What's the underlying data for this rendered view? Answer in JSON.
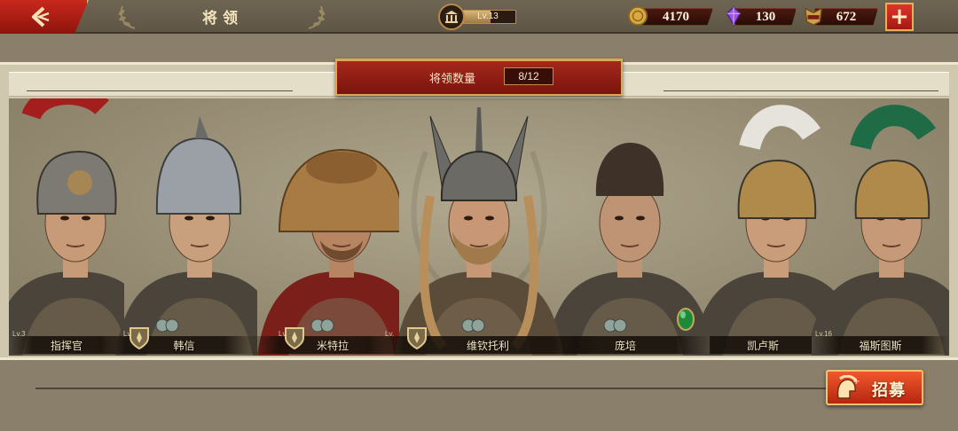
{
  "header": {
    "title": "将领",
    "level_label": "Lv.13",
    "level_progress": 0.55
  },
  "resources": [
    {
      "name": "gold",
      "icon": "gold-coin-icon",
      "value": "4170"
    },
    {
      "name": "gems",
      "icon": "purple-gem-icon",
      "value": "130"
    },
    {
      "name": "spqr",
      "icon": "spqr-token-icon",
      "value": "672"
    }
  ],
  "roster": {
    "count_label": "将领数量",
    "count_value": "8/12",
    "generals": [
      {
        "name": "指挥官",
        "level": "Lv.3",
        "has_shield": false,
        "has_coins": false,
        "has_gem": false,
        "helmet": "roman-red"
      },
      {
        "name": "韩信",
        "level": "Lv.1",
        "has_shield": true,
        "has_coins": true,
        "has_gem": false,
        "helmet": "han-steel"
      },
      {
        "name": "米特拉",
        "level": "Lv.45",
        "has_shield": true,
        "has_coins": true,
        "has_gem": false,
        "helmet": "lion-pelt"
      },
      {
        "name": "维钦托利",
        "level": "Lv.",
        "has_shield": true,
        "has_coins": true,
        "has_gem": false,
        "helmet": "winged"
      },
      {
        "name": "庞培",
        "level": "",
        "has_shield": false,
        "has_coins": true,
        "has_gem": true,
        "helmet": "none"
      },
      {
        "name": "凯卢斯",
        "level": "Lv.",
        "has_shield": false,
        "has_coins": false,
        "has_gem": false,
        "helmet": "roman-white"
      },
      {
        "name": "福斯图斯",
        "level": "Lv.16",
        "has_shield": false,
        "has_coins": false,
        "has_gem": false,
        "helmet": "roman-green"
      }
    ]
  },
  "recruit": {
    "label": "招募"
  },
  "colors": {
    "accent_red": "#b8260f",
    "gold_trim": "#d9a95b",
    "panel_bg": "#cfc7ae"
  }
}
